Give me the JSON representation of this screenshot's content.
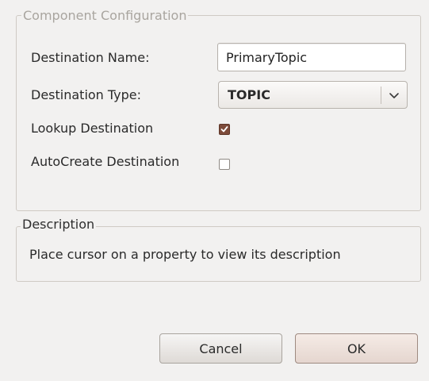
{
  "config_group": {
    "title": "Component Configuration",
    "name_label": "Destination Name:",
    "name_value": "PrimaryTopic",
    "type_label": "Destination Type:",
    "type_value": "TOPIC",
    "lookup_label": "Lookup Destination",
    "lookup_checked": true,
    "autocreate_label": "AutoCreate Destination",
    "autocreate_checked": false
  },
  "description_group": {
    "title": "Description",
    "text": "Place cursor on a property to view its description"
  },
  "buttons": {
    "cancel": "Cancel",
    "ok": "OK"
  },
  "colors": {
    "background": "#f2f1f0",
    "checkbox_checked": "#7d4b3a",
    "ok_button": "#e8dad3"
  },
  "icons": {
    "select_arrow": "chevron-down-icon",
    "checkmark": "checkmark-icon"
  }
}
